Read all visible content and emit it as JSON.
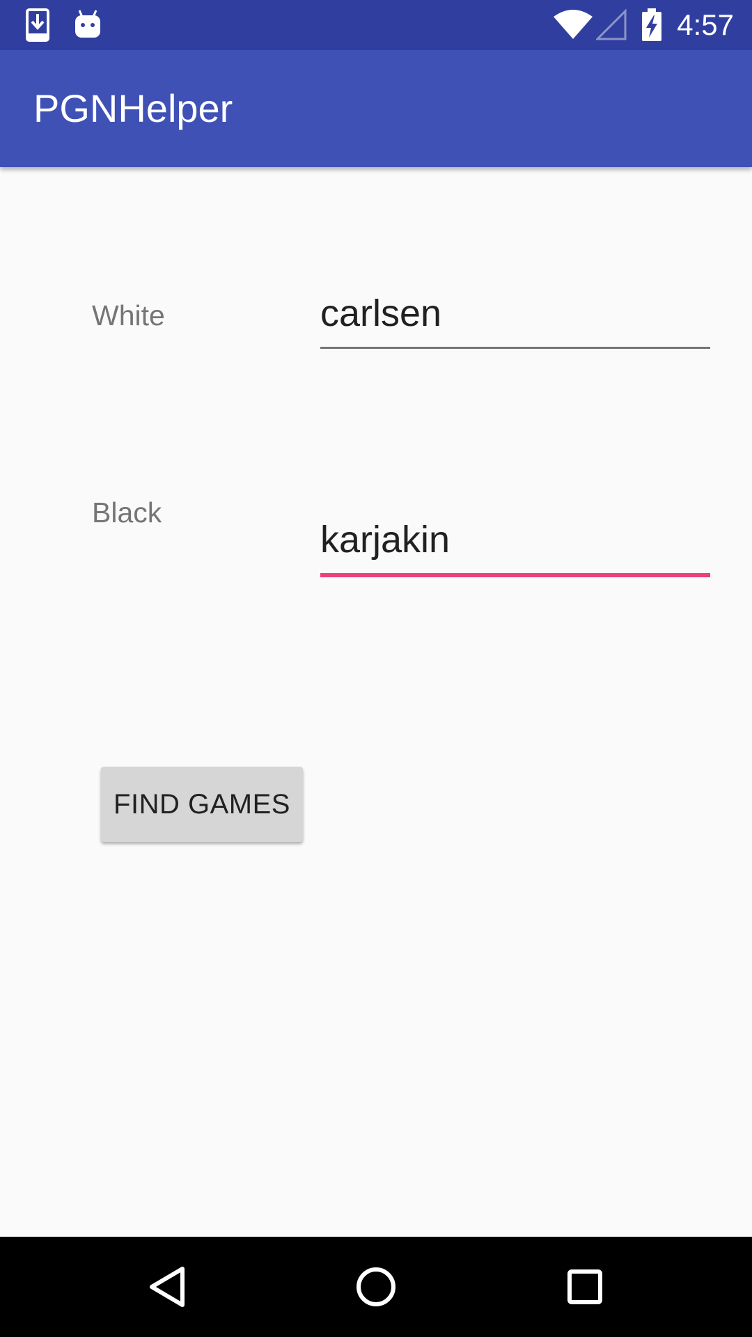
{
  "status_bar": {
    "time": "4:57",
    "left_icons": [
      "download-icon",
      "android-icon"
    ],
    "right_icons": [
      "wifi-icon",
      "cell-signal-icon",
      "battery-charging-icon"
    ]
  },
  "app_bar": {
    "title": "PGNHelper"
  },
  "form": {
    "white": {
      "label": "White",
      "value": "carlsen"
    },
    "black": {
      "label": "Black",
      "value": "karjakin"
    },
    "find_button_label": "FIND GAMES"
  },
  "nav_bar": {
    "buttons": [
      "back-icon",
      "home-icon",
      "recents-icon"
    ]
  },
  "colors": {
    "status_bar": "#303f9f",
    "app_bar": "#3f51b5",
    "accent": "#ec407a",
    "background": "#fafafa",
    "button": "#d6d6d6"
  }
}
